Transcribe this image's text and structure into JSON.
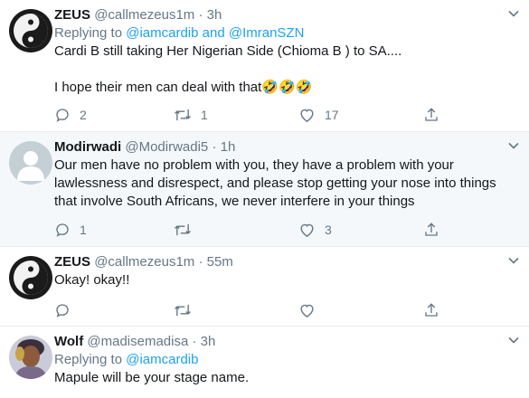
{
  "tweets": [
    {
      "name": "ZEUS",
      "handle": "@callmezeus1m",
      "sep": "·",
      "time": "3h",
      "reply_prefix": "Replying to",
      "reply_mentions": [
        "@iamcardib",
        "@ImranSZN"
      ],
      "reply_and": "and",
      "lines": [
        "Cardi B still taking Her Nigerian Side (Chioma B ) to SA....",
        "I hope their men can deal with that",
        "🤣🤣🤣"
      ],
      "counts": {
        "reply": "2",
        "retweet": "1",
        "like": "17"
      }
    },
    {
      "name": "Modirwadi",
      "handle": "@Modirwadi5",
      "sep": "·",
      "time": "1h",
      "lines": [
        "Our men have no problem with you, they have a problem with your",
        "lawlessness and disrespect, and please stop getting your nose into things",
        "that involve South Africans, we never interfere in your things"
      ],
      "counts": {
        "reply": "1",
        "retweet": "",
        "like": "3"
      }
    },
    {
      "name": "ZEUS",
      "handle": "@callmezeus1m",
      "sep": "·",
      "time": "55m",
      "lines": [
        "Okay! okay!!"
      ],
      "counts": {
        "reply": "",
        "retweet": "",
        "like": ""
      }
    },
    {
      "name": "Wolf",
      "handle": "@madisemadisa",
      "sep": "·",
      "time": "3h",
      "reply_prefix": "Replying to",
      "reply_mentions": [
        "@iamcardib"
      ],
      "lines": [
        "Mapule will be your stage name."
      ]
    }
  ],
  "icons": {
    "reply": "reply-icon",
    "retweet": "retweet-icon",
    "like": "like-icon",
    "share": "share-icon",
    "caret": "chevron-down-icon"
  },
  "colors": {
    "accent": "#1da1f2",
    "secondary_text": "#657786",
    "highlight_bg": "#f5f8fa",
    "divider": "#e6ecf0"
  }
}
